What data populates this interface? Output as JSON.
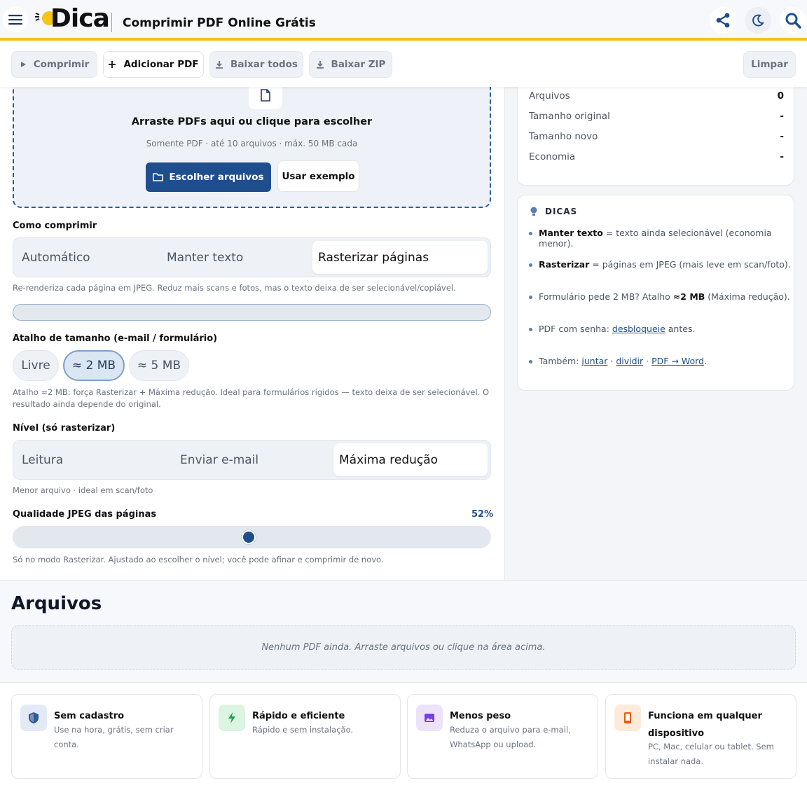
{
  "header": {
    "logo_text": "Dica",
    "title": "Comprimir PDF Online Grátis"
  },
  "toolbar": {
    "compress": "Comprimir",
    "add_pdf": "Adicionar PDF",
    "download_all": "Baixar todos",
    "download_zip": "Baixar ZIP",
    "clear": "Limpar"
  },
  "dropzone": {
    "title": "Arraste PDFs aqui ou clique para escolher",
    "subtitle": "Somente PDF · até 10 arquivos · máx. 50 MB cada",
    "choose_button": "Escolher arquivos",
    "example_button": "Usar exemplo"
  },
  "compress_mode": {
    "label": "Como comprimir",
    "options": [
      "Automático",
      "Manter texto",
      "Rasterizar páginas"
    ],
    "selected": "Rasterizar páginas",
    "help": "Re-renderiza cada página em JPEG. Reduz mais scans e fotos, mas o texto deixa de ser selecionável/copiável."
  },
  "progress": {
    "value": 0
  },
  "size_shortcut": {
    "label": "Atalho de tamanho (e-mail / formulário)",
    "options": [
      "Livre",
      "≈ 2 MB",
      "≈ 5 MB"
    ],
    "selected": "≈ 2 MB",
    "help_line1": "Atalho ≈2 MB: força Rasterizar + Máxima redução. Ideal para formulários rígidos — texto deixa de ser selecionável. O",
    "help_line2": "resultado ainda depende do original."
  },
  "level": {
    "label": "Nível (só rasterizar)",
    "options": [
      "Leitura",
      "Enviar e-mail",
      "Máxima redução"
    ],
    "selected": "Máxima redução",
    "help": "Menor arquivo · ideal em scan/foto"
  },
  "jpeg_quality": {
    "label": "Qualidade JPEG das páginas",
    "value_text": "52%",
    "value": 0.52,
    "help": "Só no modo Rasterizar. Ajustado ao escolher o nível; você pode afinar e comprimir de novo."
  },
  "stats": [
    {
      "label": "Arquivos",
      "value": "0"
    },
    {
      "label": "Tamanho original",
      "value": "-"
    },
    {
      "label": "Tamanho novo",
      "value": "-"
    },
    {
      "label": "Economia",
      "value": "-"
    }
  ],
  "tips": {
    "title": "DICAS",
    "t1_bold": "Manter texto",
    "t1_rest": " = texto ainda selecionável (economia menor).",
    "t2_bold": "Rasterizar",
    "t2_rest": " = páginas em JPEG (mais leve em scan/foto).",
    "t3_pre": "Formulário pede 2 MB? Atalho ",
    "t3_bold": "≈2 MB",
    "t3_post": " (Máxima redução).",
    "t4_pre": "PDF com senha: ",
    "t4_link": "desbloqueie",
    "t4_post": " antes.",
    "t5_pre": "Também: ",
    "t5_link1": "juntar",
    "t5_sep1": " · ",
    "t5_link2": "dividir",
    "t5_sep2": " · ",
    "t5_link3": "PDF → Word",
    "t5_post": "."
  },
  "files": {
    "title": "Arquivos",
    "empty": "Nenhum PDF ainda. Arraste arquivos ou clique na área acima."
  },
  "features": [
    {
      "title": "Sem cadastro",
      "desc": "Use na hora, grátis, sem criar conta.",
      "icon": "shield-icon",
      "color": "#2f5b96"
    },
    {
      "title": "Rápido e eficiente",
      "desc": "Rápido e sem instalação.",
      "icon": "bolt-icon",
      "color": "#16a34a"
    },
    {
      "title": "Menos peso",
      "desc_line1": "Reduza o arquivo para e-mail,",
      "desc_line2": "WhatsApp ou upload.",
      "icon": "image-icon",
      "color": "#7c3aed"
    },
    {
      "title_line1": "Funciona em qualquer",
      "title_line2": "dispositivo",
      "desc_line1": "PC, Mac, celular ou tablet. Sem",
      "desc_line2": "instalar nada.",
      "icon": "phone-icon",
      "color": "#ea580c"
    }
  ],
  "colors": {
    "accent": "#1f4e8f",
    "header_bar": "#f1c21b"
  }
}
